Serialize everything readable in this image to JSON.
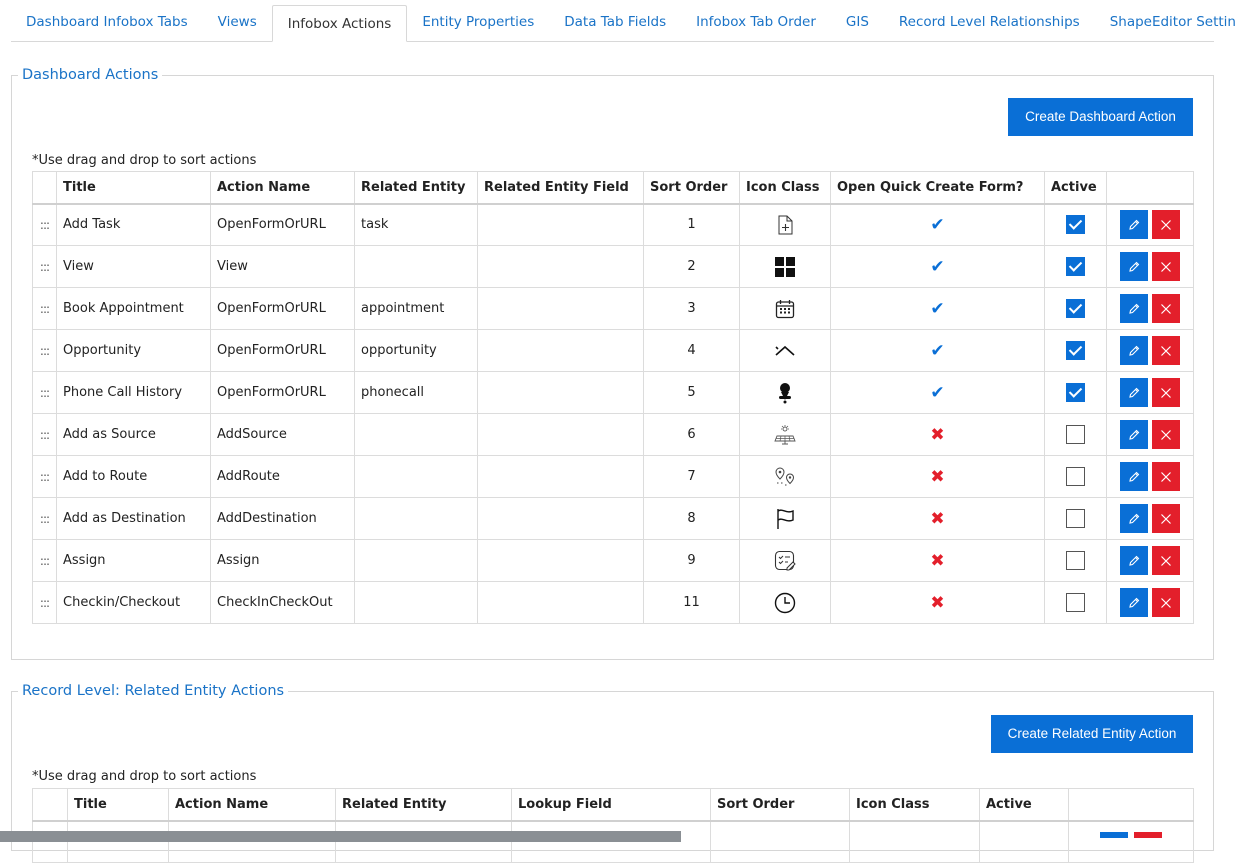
{
  "tabs": [
    {
      "label": "Dashboard Infobox Tabs",
      "active": false
    },
    {
      "label": "Views",
      "active": false
    },
    {
      "label": "Infobox Actions",
      "active": true
    },
    {
      "label": "Entity Properties",
      "active": false
    },
    {
      "label": "Data Tab Fields",
      "active": false
    },
    {
      "label": "Infobox Tab Order",
      "active": false
    },
    {
      "label": "GIS",
      "active": false
    },
    {
      "label": "Record Level Relationships",
      "active": false
    },
    {
      "label": "ShapeEditor Settings",
      "active": false
    }
  ],
  "dashboard": {
    "legend": "Dashboard Actions",
    "create_label": "Create Dashboard Action",
    "hint": "*Use drag and drop to sort actions",
    "columns": [
      "",
      "Title",
      "Action Name",
      "Related Entity",
      "Related Entity Field",
      "Sort Order",
      "Icon Class",
      "Open Quick Create Form?",
      "Active",
      ""
    ],
    "rows": [
      {
        "handle": ":::",
        "title": "Add Task",
        "action": "OpenFormOrURL",
        "entity": "task",
        "field": "",
        "sort": "1",
        "icon": "add-document-icon",
        "quick_create": true,
        "active": true
      },
      {
        "handle": ":::",
        "title": "View",
        "action": "View",
        "entity": "",
        "field": "",
        "sort": "2",
        "icon": "grid-icon",
        "quick_create": true,
        "active": true
      },
      {
        "handle": ":::",
        "title": "Book Appointment",
        "action": "OpenFormOrURL",
        "entity": "appointment",
        "field": "",
        "sort": "3",
        "icon": "calendar-icon",
        "quick_create": true,
        "active": true
      },
      {
        "handle": ":::",
        "title": "Opportunity",
        "action": "OpenFormOrURL",
        "entity": "opportunity",
        "field": "",
        "sort": "4",
        "icon": "chevron-up-icon",
        "quick_create": true,
        "active": true
      },
      {
        "handle": ":::",
        "title": "Phone Call History",
        "action": "OpenFormOrURL",
        "entity": "phonecall",
        "field": "",
        "sort": "5",
        "icon": "pin-icon",
        "quick_create": true,
        "active": true
      },
      {
        "handle": ":::",
        "title": "Add as Source",
        "action": "AddSource",
        "entity": "",
        "field": "",
        "sort": "6",
        "icon": "solar-panel-icon",
        "quick_create": false,
        "active": false
      },
      {
        "handle": ":::",
        "title": "Add to Route",
        "action": "AddRoute",
        "entity": "",
        "field": "",
        "sort": "7",
        "icon": "route-icon",
        "quick_create": false,
        "active": false
      },
      {
        "handle": ":::",
        "title": "Add as Destination",
        "action": "AddDestination",
        "entity": "",
        "field": "",
        "sort": "8",
        "icon": "flag-icon",
        "quick_create": false,
        "active": false
      },
      {
        "handle": ":::",
        "title": "Assign",
        "action": "Assign",
        "entity": "",
        "field": "",
        "sort": "9",
        "icon": "assign-checklist-icon",
        "quick_create": false,
        "active": false
      },
      {
        "handle": ":::",
        "title": "Checkin/Checkout",
        "action": "CheckInCheckOut",
        "entity": "",
        "field": "",
        "sort": "11",
        "icon": "clock-icon",
        "quick_create": false,
        "active": false
      }
    ]
  },
  "related": {
    "legend": "Record Level: Related Entity Actions",
    "create_label": "Create Related Entity Action",
    "hint": "*Use drag and drop to sort actions",
    "columns": [
      "",
      "Title",
      "Action Name",
      "Related Entity",
      "Lookup Field",
      "Sort Order",
      "Icon Class",
      "Active",
      ""
    ]
  },
  "colors": {
    "accent": "#0a6fd6",
    "link": "#1a73c7",
    "danger": "#e31f2b"
  }
}
